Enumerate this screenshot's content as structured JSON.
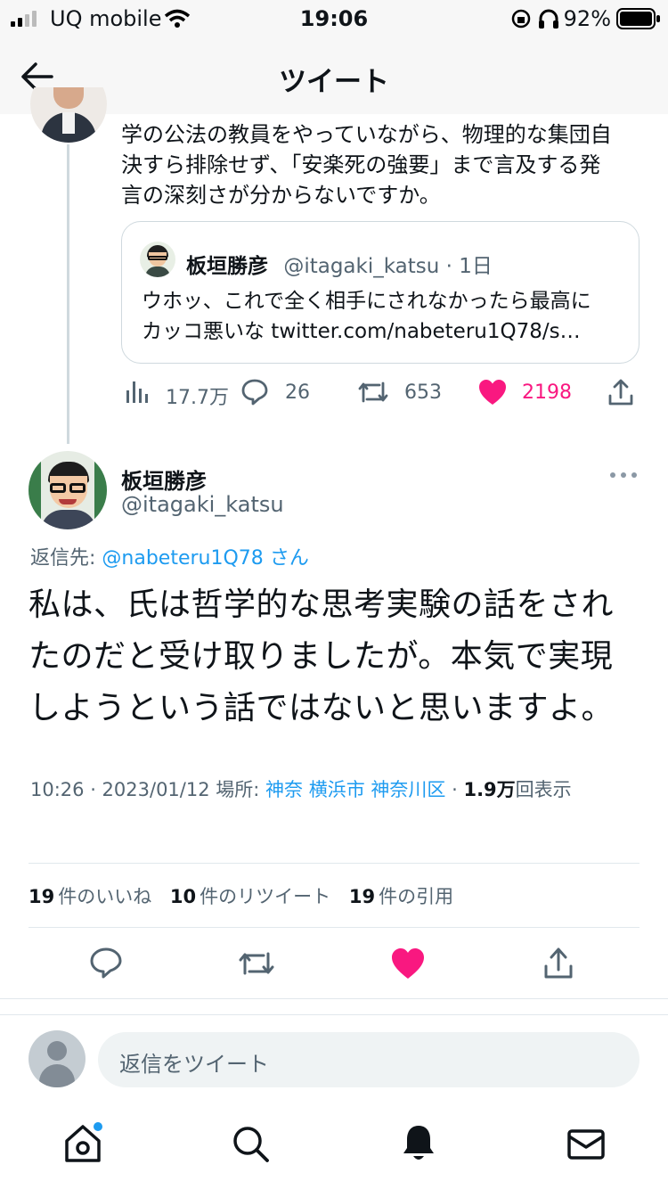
{
  "status_bar": {
    "carrier": "UQ mobile",
    "time": "19:06",
    "battery": "92%"
  },
  "header": {
    "title": "ツイート"
  },
  "parent_tweet": {
    "text_lines": [
      "学の公法の教員をやっていながら、物理的な集団自",
      "決すら排除せず、「安楽死の強要」まで言及する発",
      "言の深刻さが分からないですか。"
    ],
    "quote": {
      "name": "板垣勝彦",
      "handle": "@itagaki_katsu",
      "age": "1日",
      "line1": "ウホッ、これで全く相手にされなかったら最高に",
      "line2": "カッコ悪いな twitter.com/nabeteru1Q78/s…"
    },
    "stats": {
      "views": "17.7万",
      "replies": "26",
      "retweets": "653",
      "likes": "2198"
    }
  },
  "main_tweet": {
    "name": "板垣勝彦",
    "handle": "@itagaki_katsu",
    "reply_to_label": "返信先:",
    "reply_to_handle": "@nabeteru1Q78",
    "reply_to_suffix": "さん",
    "text_lines": [
      "私は、氏は哲学的な思考実験の話をされ",
      "たのだと受け取りましたが。本気で実現",
      "しようという話ではないと思いますよ。"
    ],
    "meta": {
      "time": "10:26 · 2023/01/12",
      "place_label": "場所:",
      "place": "神奈 横浜市 神奈川区",
      "sep": "·",
      "views_value": "1.9万",
      "views_label": "回表示"
    },
    "counts": {
      "likes_value": "19",
      "likes_label": "件のいいね",
      "retweets_value": "10",
      "retweets_label": "件のリツイート",
      "quotes_value": "19",
      "quotes_label": "件の引用"
    }
  },
  "reply_bar": {
    "placeholder": "返信をツイート"
  },
  "colors": {
    "accent": "#1d9bf0",
    "like": "#f91880",
    "muted": "#536471",
    "border": "#cfd9de"
  }
}
